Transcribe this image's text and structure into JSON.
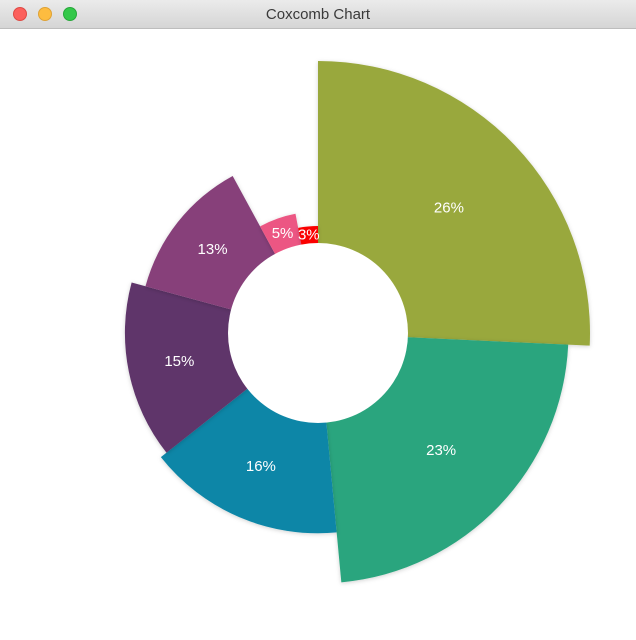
{
  "window": {
    "title": "Coxcomb Chart"
  },
  "chart_data": {
    "type": "coxcomb",
    "title": "",
    "slices": [
      {
        "value": 26,
        "label": "26%",
        "color": "#99a83c"
      },
      {
        "value": 23,
        "label": "23%",
        "color": "#2aa57e"
      },
      {
        "value": 16,
        "label": "16%",
        "color": "#0a86a7"
      },
      {
        "value": 15,
        "label": "15%",
        "color": "#5f346a"
      },
      {
        "value": 13,
        "label": "13%",
        "color": "#873f7a"
      },
      {
        "value": 5,
        "label": "5%",
        "color": "#ec5783"
      },
      {
        "value": 3,
        "label": "3%",
        "color": "#fa0004"
      }
    ]
  }
}
